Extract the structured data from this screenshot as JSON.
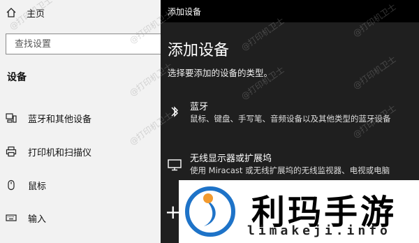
{
  "settings": {
    "home_label": "主页",
    "search_placeholder": "查找设置",
    "section_title": "设备",
    "nav": [
      {
        "label": "蓝牙和其他设备",
        "icon": "devices-icon"
      },
      {
        "label": "打印机和扫描仪",
        "icon": "printer-icon"
      },
      {
        "label": "鼠标",
        "icon": "mouse-icon"
      },
      {
        "label": "输入",
        "icon": "keyboard-icon"
      }
    ]
  },
  "dialog": {
    "window_title": "添加设备",
    "heading": "添加设备",
    "subtitle": "选择要添加的设备的类型。",
    "options": [
      {
        "name": "蓝牙",
        "desc": "鼠标、键盘、手写笔、音频设备以及其他类型的蓝牙设备",
        "icon": "bluetooth-icon"
      },
      {
        "name": "无线显示器或扩展坞",
        "desc": "使用 Miracast 或无线扩展坞的无线监视器、电视或电脑",
        "icon": "monitor-icon"
      }
    ],
    "colors": {
      "background": "#1f1f1f",
      "titlebar": "#000000",
      "text": "#ffffff"
    }
  },
  "watermark": {
    "text": "@打印机卫士"
  },
  "logo": {
    "name_cn": "利玛手游",
    "domain": "limakeji.info",
    "colors": {
      "blue": "#1e73c8",
      "orange": "#f29a2e"
    }
  }
}
